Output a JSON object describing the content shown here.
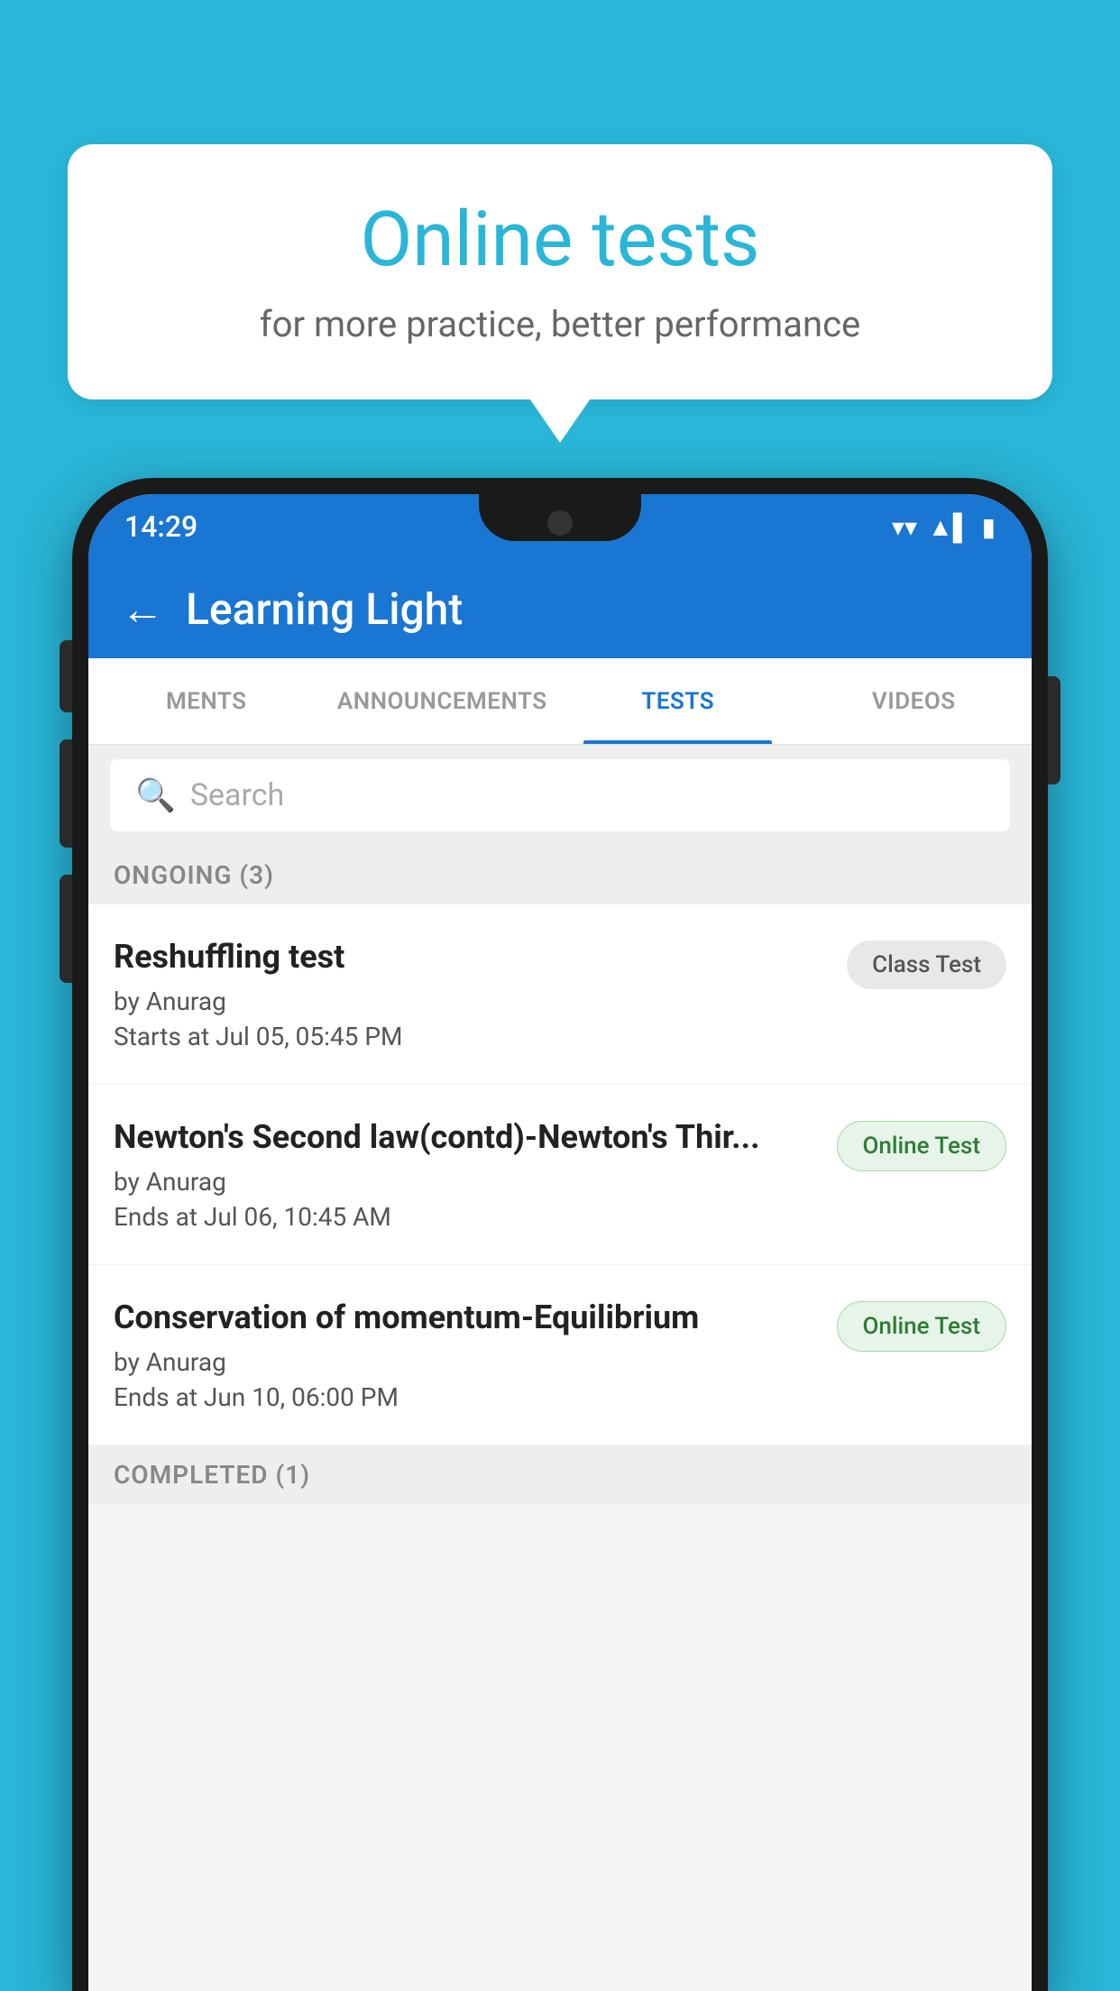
{
  "background_color": "#29b6d8",
  "speech_bubble": {
    "title": "Online tests",
    "subtitle": "for more practice, better performance"
  },
  "status_bar": {
    "time": "14:29",
    "wifi_icon": "▼",
    "signal_icon": "▲",
    "battery_icon": "▮"
  },
  "app_bar": {
    "back_label": "←",
    "title": "Learning Light"
  },
  "tabs": [
    {
      "label": "MENTS",
      "active": false
    },
    {
      "label": "ANNOUNCEMENTS",
      "active": false
    },
    {
      "label": "TESTS",
      "active": true
    },
    {
      "label": "VIDEOS",
      "active": false
    }
  ],
  "search": {
    "placeholder": "Search"
  },
  "ongoing_section": {
    "header": "ONGOING (3)",
    "tests": [
      {
        "title": "Reshuffling test",
        "author": "by Anurag",
        "date": "Starts at  Jul 05, 05:45 PM",
        "badge": "Class Test",
        "badge_type": "class"
      },
      {
        "title": "Newton's Second law(contd)-Newton's Thir...",
        "author": "by Anurag",
        "date": "Ends at  Jul 06, 10:45 AM",
        "badge": "Online Test",
        "badge_type": "online"
      },
      {
        "title": "Conservation of momentum-Equilibrium",
        "author": "by Anurag",
        "date": "Ends at  Jun 10, 06:00 PM",
        "badge": "Online Test",
        "badge_type": "online"
      }
    ]
  },
  "completed_section": {
    "header": "COMPLETED (1)"
  }
}
